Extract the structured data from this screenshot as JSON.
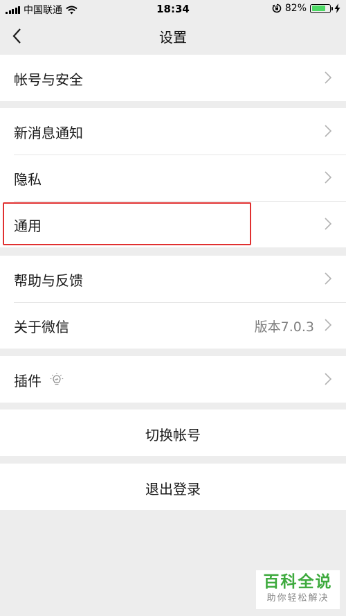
{
  "status_bar": {
    "carrier": "中国联通",
    "time": "18:34",
    "battery": "82%",
    "battery_level": 0.82
  },
  "nav": {
    "title": "设置"
  },
  "settings": {
    "account_security": "帐号与安全",
    "new_message": "新消息通知",
    "privacy": "隐私",
    "general": "通用",
    "help_feedback": "帮助与反馈",
    "about": "关于微信",
    "version": "版本7.0.3",
    "plugins": "插件",
    "switch_account": "切换帐号",
    "logout": "退出登录"
  },
  "watermark": {
    "main": "百科全说",
    "sub": "助你轻松解决"
  },
  "colors": {
    "background": "#ededed",
    "highlight": "#e03030",
    "battery": "#4cd964",
    "watermark": "#3eaa3e"
  }
}
